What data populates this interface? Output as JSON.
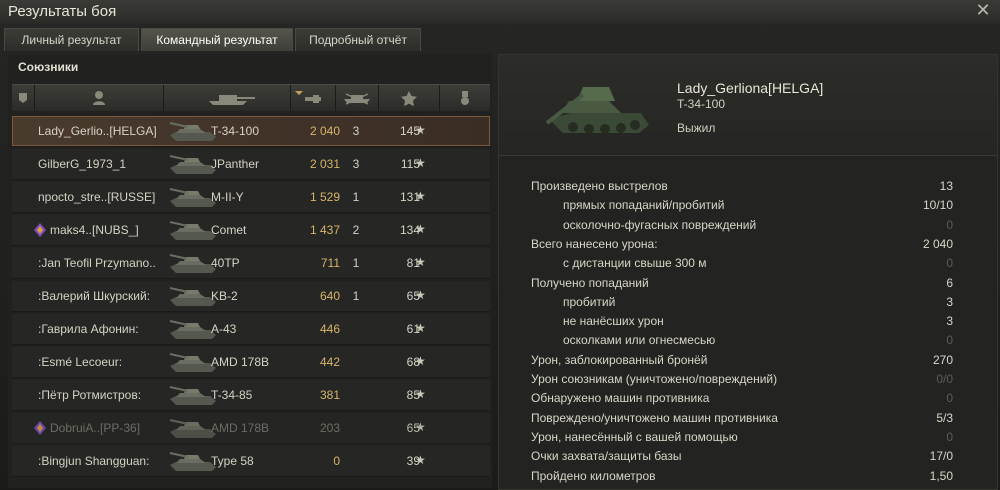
{
  "window": {
    "title": "Результаты боя",
    "close_icon": "close-icon"
  },
  "tabs": [
    {
      "label": "Личный результат",
      "active": false
    },
    {
      "label": "Командный результат",
      "active": true
    },
    {
      "label": "Подробный отчёт",
      "active": false
    }
  ],
  "allies": {
    "title": "Союзники",
    "columns": [
      "vehicle-type-icon",
      "player-icon",
      "tank-icon",
      "damage-icon",
      "kills-icon",
      "xp-star-icon",
      "medal-icon"
    ],
    "rows": [
      {
        "name": "Lady_Gerlio..[HELGA]",
        "tank": "T-34-100",
        "damage": "2 040",
        "kills": "3",
        "xp": "145",
        "selected": true,
        "destroyed": false,
        "clan_icon": ""
      },
      {
        "name": "GilberG_1973_1",
        "tank": "JPanther",
        "damage": "2 031",
        "kills": "3",
        "xp": "115",
        "selected": false,
        "destroyed": false,
        "clan_icon": ""
      },
      {
        "name": "npocto_stre..[RUSSE]",
        "tank": "M-II-Y",
        "damage": "1 529",
        "kills": "1",
        "xp": "131",
        "selected": false,
        "destroyed": false,
        "clan_icon": ""
      },
      {
        "name": "maks4..[NUBS_]",
        "tank": "Comet",
        "damage": "1 437",
        "kills": "2",
        "xp": "134",
        "selected": false,
        "destroyed": false,
        "clan_icon": "clan-emblem-icon"
      },
      {
        "name": ":Jan Teofil Przymano..",
        "tank": "40TP",
        "damage": "711",
        "kills": "1",
        "xp": "81",
        "selected": false,
        "destroyed": false,
        "clan_icon": ""
      },
      {
        "name": ":Валерий Шкурский:",
        "tank": "KB-2",
        "damage": "640",
        "kills": "1",
        "xp": "65",
        "selected": false,
        "destroyed": false,
        "clan_icon": ""
      },
      {
        "name": ":Гаврила Афонин:",
        "tank": "A-43",
        "damage": "446",
        "kills": "",
        "xp": "61",
        "selected": false,
        "destroyed": false,
        "clan_icon": ""
      },
      {
        "name": ":Esmé Lecoeur:",
        "tank": "AMD 178B",
        "damage": "442",
        "kills": "",
        "xp": "68",
        "selected": false,
        "destroyed": false,
        "clan_icon": ""
      },
      {
        "name": ":Пётр Ротмистров:",
        "tank": "T-34-85",
        "damage": "381",
        "kills": "",
        "xp": "85",
        "selected": false,
        "destroyed": false,
        "clan_icon": ""
      },
      {
        "name": "DobruiA..[PP-36]",
        "tank": "AMD 178B",
        "damage": "203",
        "kills": "",
        "xp": "65",
        "selected": false,
        "destroyed": true,
        "clan_icon": "clan-emblem-icon"
      },
      {
        "name": ":Bingjun Shangguan:",
        "tank": "Type 58",
        "damage": "0",
        "kills": "",
        "xp": "39",
        "selected": false,
        "destroyed": false,
        "clan_icon": ""
      }
    ],
    "star_glyph": "★"
  },
  "details": {
    "player": "Lady_Gerliona[HELGA]",
    "tank": "T-34-100",
    "status": "Выжил",
    "stats": [
      {
        "label": "Произведено выстрелов",
        "value": "13",
        "indent": false,
        "muted": false
      },
      {
        "label": "прямых попаданий/пробитий",
        "value": "10/10",
        "indent": true,
        "muted": false
      },
      {
        "label": "осколочно-фугасных повреждений",
        "value": "0",
        "indent": true,
        "muted": true
      },
      {
        "label": "Всего нанесено урона:",
        "value": "2 040",
        "indent": false,
        "muted": false
      },
      {
        "label": "с дистанции свыше 300 м",
        "value": "0",
        "indent": true,
        "muted": true
      },
      {
        "label": "Получено попаданий",
        "value": "6",
        "indent": false,
        "muted": false
      },
      {
        "label": "пробитий",
        "value": "3",
        "indent": true,
        "muted": false
      },
      {
        "label": "не нанёсших урон",
        "value": "3",
        "indent": true,
        "muted": false
      },
      {
        "label": "осколками или огнесмесью",
        "value": "0",
        "indent": true,
        "muted": true
      },
      {
        "label": "Урон, заблокированный бронёй",
        "value": "270",
        "indent": false,
        "muted": false
      },
      {
        "label": "Урон союзникам (уничтожено/повреждений)",
        "value": "0/0",
        "indent": false,
        "muted": true
      },
      {
        "label": "Обнаружено машин противника",
        "value": "0",
        "indent": false,
        "muted": true
      },
      {
        "label": "Повреждено/уничтожено машин противника",
        "value": "5/3",
        "indent": false,
        "muted": false
      },
      {
        "label": "Урон, нанесённый с вашей помощью",
        "value": "0",
        "indent": false,
        "muted": true
      },
      {
        "label": "Очки захвата/защиты базы",
        "value": "17/0",
        "indent": false,
        "muted": false
      },
      {
        "label": "Пройдено километров",
        "value": "1,50",
        "indent": false,
        "muted": false
      }
    ]
  }
}
